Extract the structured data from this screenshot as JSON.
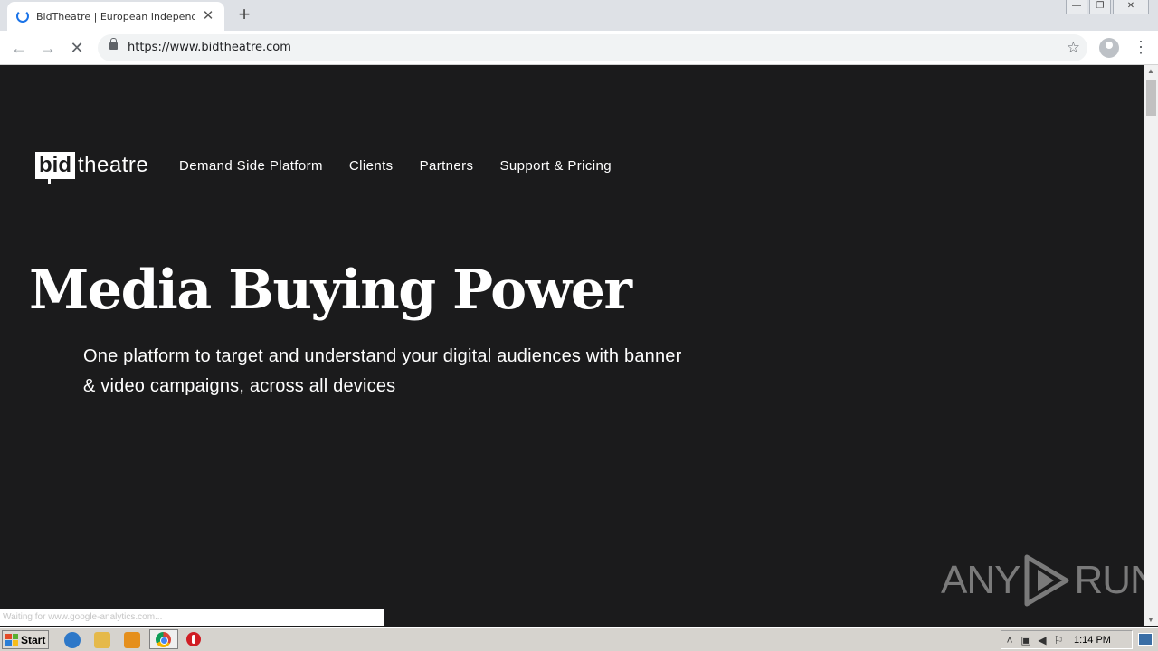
{
  "browser": {
    "tab_title": "BidTheatre | European Independent",
    "tab_close_glyph": "✕",
    "new_tab_glyph": "+",
    "url": "https://www.bidtheatre.com",
    "back_glyph": "←",
    "forward_glyph": "→",
    "reload_glyph": "✕",
    "star_glyph": "☆",
    "menu_glyph": "⋮",
    "window_controls": {
      "minimize": "—",
      "restore": "❐",
      "close": "✕"
    }
  },
  "site": {
    "logo_bid": "bid",
    "logo_theatre": "theatre",
    "nav": [
      "Demand Side Platform",
      "Clients",
      "Partners",
      "Support & Pricing"
    ],
    "hero_title": "Media Buying Power",
    "hero_subtitle": "One platform to target and understand your digital audiences with banner & video campaigns, across all devices"
  },
  "status_text": "Waiting for www.google-analytics.com...",
  "watermark": {
    "left": "ANY",
    "right": "RUN"
  },
  "taskbar": {
    "start_label": "Start",
    "clock": "1:14 PM",
    "tray_icons": [
      "chevron-up-icon",
      "network-icon",
      "volume-icon",
      "flag-icon"
    ]
  },
  "colors": {
    "page_bg": "#1b1b1c",
    "text": "#ffffff",
    "watermark": "#7a7a7a"
  }
}
